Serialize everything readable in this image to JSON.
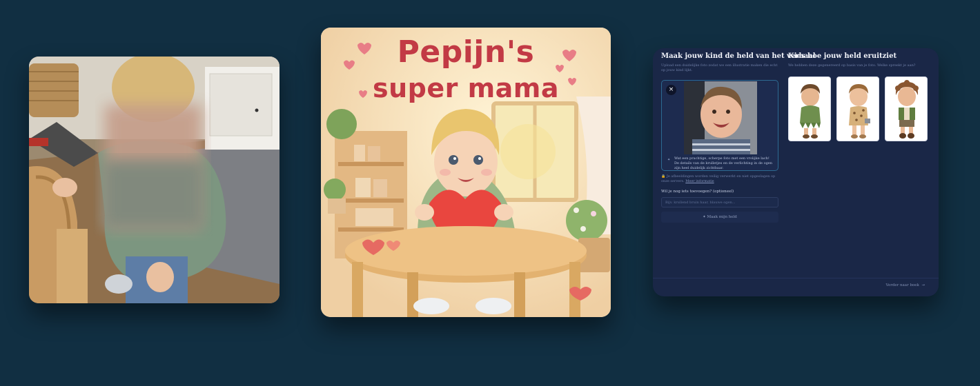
{
  "colors": {
    "background": "#112f42",
    "panel": "#1a2747",
    "panel_border_active": "#2d6a92",
    "title_red": "#c23a45",
    "muted_text": "#6e7ea6"
  },
  "cover": {
    "title_line1": "Pepijn's",
    "title_line2": "super mama"
  },
  "form": {
    "heading": "Maak jouw kind de held van het verhaal",
    "intro": "Upload een duidelijke foto zodat we een illustratie maken die echt op jouw kind lijkt.",
    "remove_icon": "close-icon",
    "feedback": "Wat een prachtige, scherpe foto met een vrolijke lach! De details van de krulletjes en de verlichting in de ogen zijn heel duidelijk zichtbaar.",
    "privacy_note": "Je afbeeldingen worden veilig verwerkt en niet opgeslagen op onze servers.",
    "privacy_link": "Meer informatie",
    "extra_label": "Wil je nog iets toevoegen? (optioneel)",
    "extra_placeholder": "Bijv. krullend bruin haar, blauwe ogen...",
    "make_button": "✦ Maak mijn held"
  },
  "heroes": {
    "heading": "Kies hoe jouw held eruitziet",
    "intro": "We hebben deze gegenereerd op basis van je foto. Welke spreekt je aan?",
    "options": [
      {
        "outfit": "green-leaf-outfit"
      },
      {
        "outfit": "leopard-tunic"
      },
      {
        "outfit": "green-vest"
      }
    ]
  },
  "footer": {
    "next_button": "Verder naar boek",
    "next_icon": "arrow-right-icon"
  }
}
